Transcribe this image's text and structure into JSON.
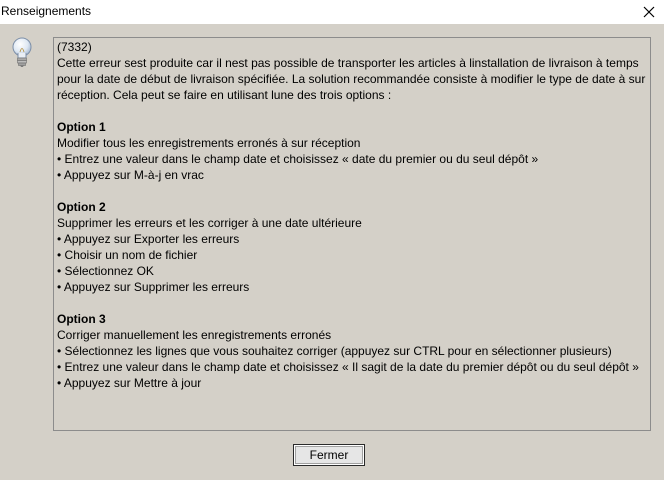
{
  "window": {
    "title": "Renseignements"
  },
  "message": {
    "code": "(7332)",
    "intro": [
      "Cette erreur sest produite car il nest pas possible de transporter les articles à linstallation de livraison à temps",
      "pour la date de début de livraison spécifiée. La solution recommandée consiste à modifier le type de date à sur",
      "réception. Cela peut se faire en utilisant lune des trois options :"
    ],
    "options": [
      {
        "title": "Option 1",
        "lines": [
          "Modifier tous les enregistrements erronés à sur réception",
          "• Entrez une valeur dans le champ date et choisissez « date du premier ou du seul dépôt »",
          "• Appuyez sur M-à-j en vrac"
        ]
      },
      {
        "title": "Option 2",
        "lines": [
          "Supprimer les erreurs et les corriger à une date ultérieure",
          "• Appuyez sur Exporter les erreurs",
          "• Choisir un nom de fichier",
          "• Sélectionnez OK",
          "• Appuyez sur Supprimer les erreurs"
        ]
      },
      {
        "title": "Option 3",
        "lines": [
          "Corriger manuellement les enregistrements erronés",
          "• Sélectionnez les lignes que vous souhaitez corriger (appuyez sur CTRL pour en sélectionner plusieurs)",
          "• Entrez une valeur dans le champ date et choisissez « Il sagit de la date du premier dépôt ou du seul dépôt »",
          "• Appuyez sur Mettre à jour"
        ]
      }
    ]
  },
  "buttons": {
    "close_label": "Fermer"
  },
  "icons": {
    "info": "lightbulb-icon",
    "close": "close-icon"
  }
}
